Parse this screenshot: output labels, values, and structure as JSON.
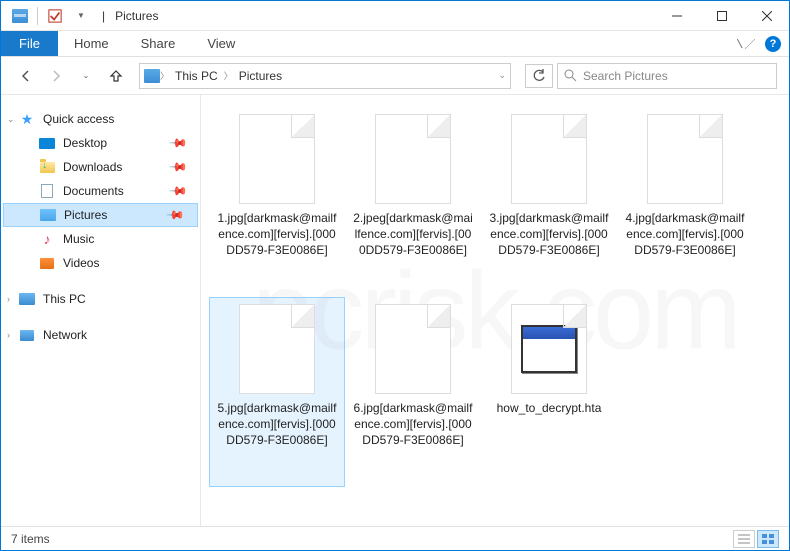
{
  "titlebar": {
    "title": "Pictures",
    "sep": "|"
  },
  "ribbon": {
    "file": "File",
    "tabs": [
      "Home",
      "Share",
      "View"
    ]
  },
  "nav": {
    "breadcrumb": [
      "This PC",
      "Pictures"
    ],
    "search_placeholder": "Search Pictures"
  },
  "sidebar": {
    "quick_access": "Quick access",
    "items": [
      {
        "label": "Desktop",
        "pinned": true
      },
      {
        "label": "Downloads",
        "pinned": true
      },
      {
        "label": "Documents",
        "pinned": true
      },
      {
        "label": "Pictures",
        "pinned": true,
        "selected": true
      },
      {
        "label": "Music",
        "pinned": false
      },
      {
        "label": "Videos",
        "pinned": false
      }
    ],
    "this_pc": "This PC",
    "network": "Network"
  },
  "files": [
    {
      "name": "1.jpg[darkmask@mailfence.com][fervis].[000DD579-F3E0086E]",
      "type": "file"
    },
    {
      "name": "2.jpeg[darkmask@mailfence.com][fervis].[000DD579-F3E0086E]",
      "type": "file"
    },
    {
      "name": "3.jpg[darkmask@mailfence.com][fervis].[000DD579-F3E0086E]",
      "type": "file"
    },
    {
      "name": "4.jpg[darkmask@mailfence.com][fervis].[000DD579-F3E0086E]",
      "type": "file"
    },
    {
      "name": "5.jpg[darkmask@mailfence.com][fervis].[000DD579-F3E0086E]",
      "type": "file",
      "selected": true
    },
    {
      "name": "6.jpg[darkmask@mailfence.com][fervis].[000DD579-F3E0086E]",
      "type": "file"
    },
    {
      "name": "how_to_decrypt.hta",
      "type": "hta"
    }
  ],
  "status": {
    "count": "7 items"
  },
  "help_tooltip": "?"
}
